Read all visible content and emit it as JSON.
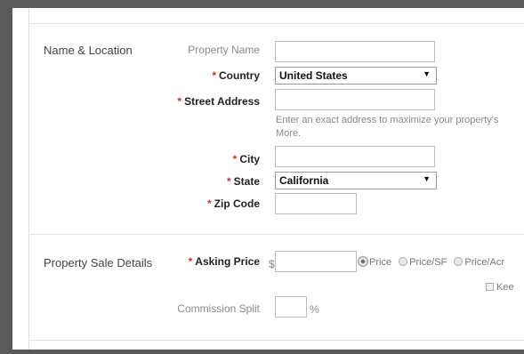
{
  "name_location": {
    "section_title": "Name & Location",
    "property_name_label": "Property Name",
    "property_name_value": "",
    "country_label": "Country",
    "country_value": "United States",
    "street_label": "Street Address",
    "street_value": "",
    "street_help_line1": "Enter an exact address to maximize your property's",
    "street_help_line2": "More.",
    "city_label": "City",
    "city_value": "",
    "state_label": "State",
    "state_value": "California",
    "zip_label": "Zip Code",
    "zip_value": ""
  },
  "sale_details": {
    "section_title": "Property Sale Details",
    "asking_price_label": "Asking Price",
    "currency_symbol": "$",
    "asking_price_value": "",
    "radio_price": "Price",
    "radio_price_sf": "Price/SF",
    "radio_price_acre": "Price/Acr",
    "keep_label": "Kee",
    "commission_label": "Commission Split",
    "commission_value": "",
    "percent_symbol": "%"
  },
  "required_marker": "*",
  "select_caret_icon": "triangle-down",
  "colors": {
    "required_star": "#c0392b",
    "outer_frame": "#5a5a5a"
  }
}
